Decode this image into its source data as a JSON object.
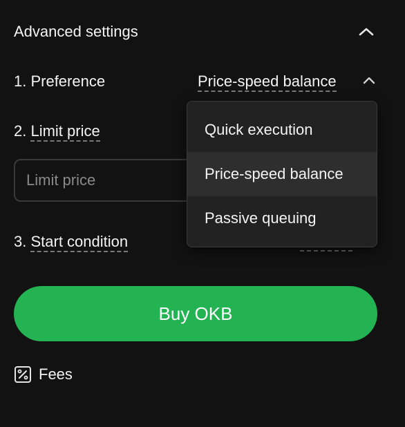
{
  "header": {
    "title": "Advanced settings",
    "collapse_icon": "chevron-up-icon"
  },
  "preference": {
    "label": "1. Preference",
    "value": "Price-speed balance",
    "toggle_icon": "chevron-up-icon"
  },
  "limit_price": {
    "label": "2. Limit price",
    "placeholder": "Limit price",
    "value": ""
  },
  "start_condition": {
    "label": "3. Start condition"
  },
  "dropdown": {
    "options": [
      {
        "label": "Quick execution",
        "selected": false
      },
      {
        "label": "Price-speed balance",
        "selected": true
      },
      {
        "label": "Passive queuing",
        "selected": false
      }
    ]
  },
  "buy_button": {
    "label": "Buy OKB",
    "color": "#23b352"
  },
  "fees": {
    "label": "Fees",
    "icon": "percent-icon"
  }
}
